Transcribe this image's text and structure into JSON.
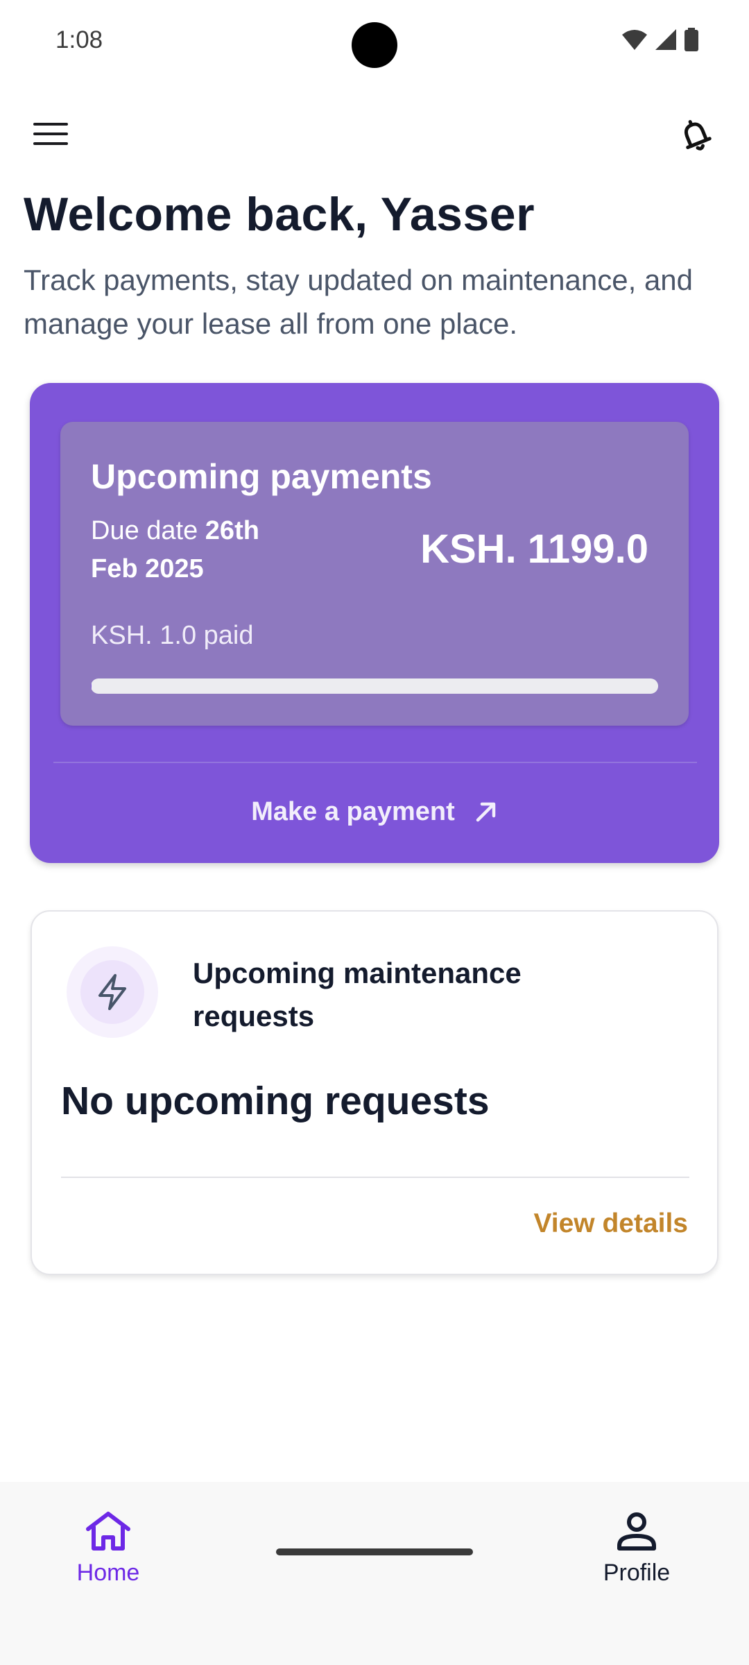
{
  "status_bar": {
    "time": "1:08"
  },
  "header": {
    "title": "Welcome back, Yasser",
    "subtitle": "Track payments, stay updated on maintenance, and manage your lease all from one place."
  },
  "payment_card": {
    "title": "Upcoming payments",
    "due_prefix": "Due date ",
    "due_date": "26th Feb 2025",
    "amount": "KSH. 1199.0",
    "paid": "KSH. 1.0 paid",
    "progress_fraction": 0.0008,
    "action_label": "Make a payment",
    "card_color": "#7e55d9"
  },
  "maintenance_card": {
    "title": "Upcoming maintenance requests",
    "empty_text": "No upcoming requests",
    "link_label": "View details",
    "link_color": "#c2852a"
  },
  "bottom_nav": {
    "items": [
      {
        "label": "Home",
        "icon": "home-icon",
        "active": true
      },
      {
        "label": "Profile",
        "icon": "person-icon",
        "active": false
      }
    ],
    "active_color": "#6d28e6"
  }
}
